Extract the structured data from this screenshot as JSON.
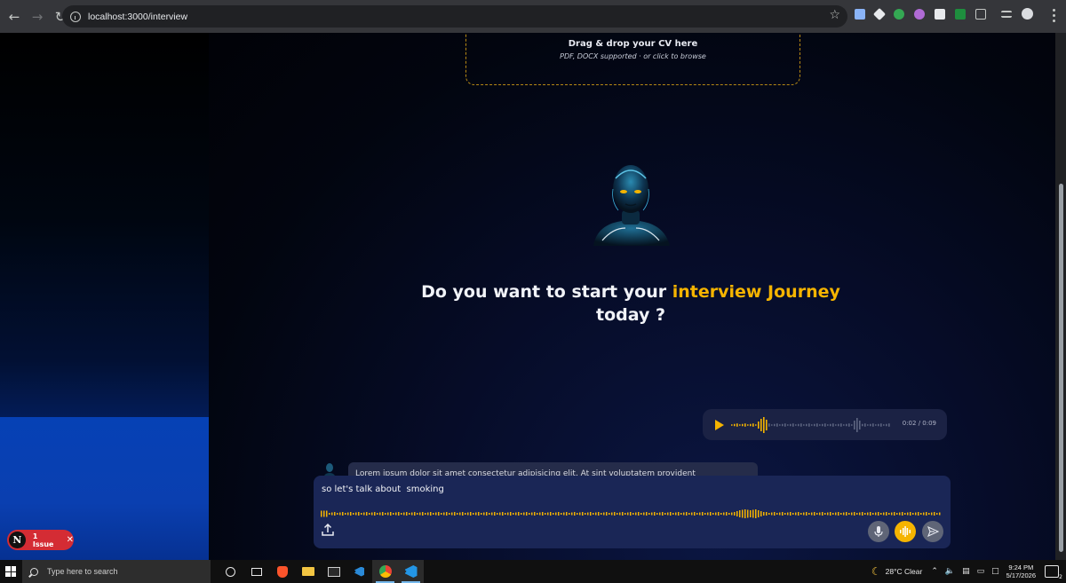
{
  "browser": {
    "url": "localhost:3000/interview"
  },
  "upload": {
    "title": "Drag & drop your CV here",
    "subtitle": "PDF, DOCX supported · or click to browse"
  },
  "hero": {
    "headline_part1": "Do you want to start your ",
    "headline_accent": "interview Journey",
    "headline_part2": "today ?"
  },
  "audio_message": {
    "time": "0:02 / 0:09"
  },
  "bot_message": {
    "text": "Lorem ipsum dolor sit amet consectetur adipisicing elit. At sint voluptatem provident"
  },
  "composer": {
    "input_value": "so let's talk about  smoking"
  },
  "dev_overlay": {
    "logo": "N",
    "issue_label": "1 Issue",
    "close": "✕"
  },
  "taskbar": {
    "search_placeholder": "Type here to search",
    "weather": "28°C  Clear",
    "time": "9:24 PM",
    "date": "5/17/2026",
    "notification_count": "2"
  },
  "colors": {
    "accent": "#f5b400",
    "issue_red": "#d42c34",
    "composer_bg": "#1a2656"
  }
}
